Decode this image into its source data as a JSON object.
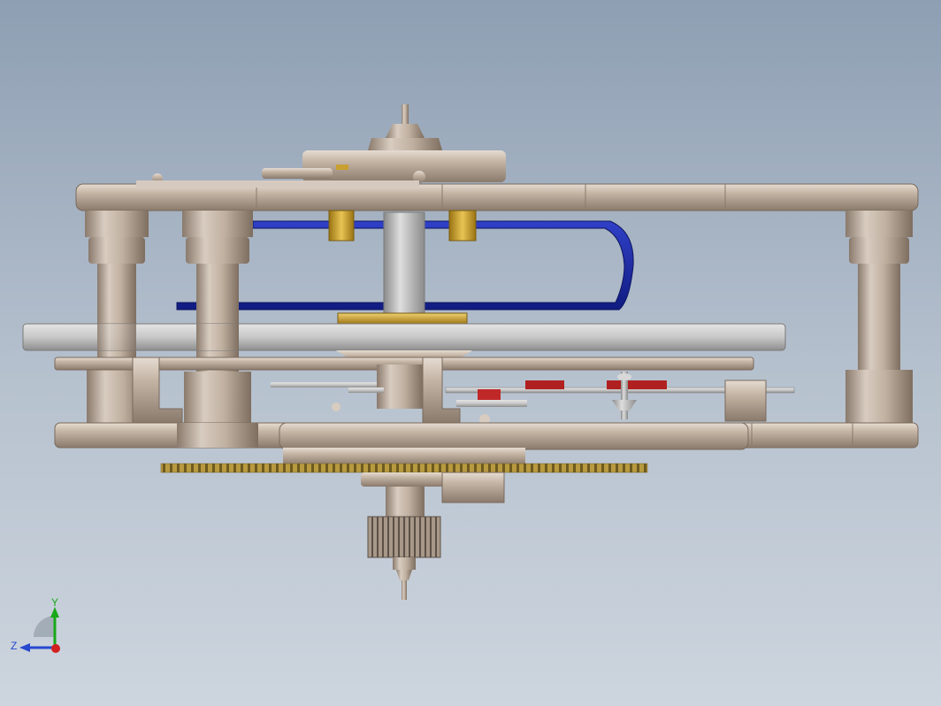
{
  "viewport": {
    "background_top": "#8e9fb3",
    "background_bottom": "#cdd5de"
  },
  "model_colors": {
    "frame_metal": "#b8a898",
    "spring_blue": "#1a2aa0",
    "brass": "#c8a030",
    "jewel_red": "#b02020",
    "steel": "#b0b0b0"
  },
  "triad": {
    "y_label": "Y",
    "z_label": "Z",
    "y_color": "#18a818",
    "z_color": "#2848d0",
    "x_color": "#d02020"
  }
}
